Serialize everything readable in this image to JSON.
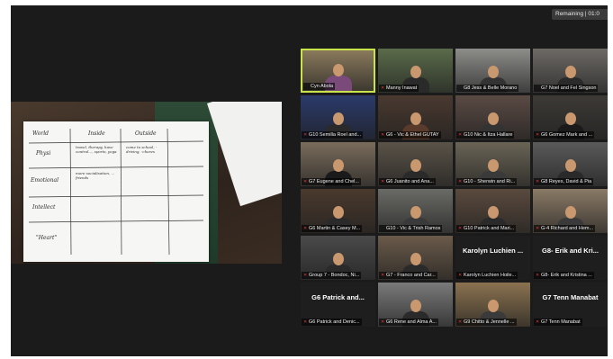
{
  "remaining": "Remaining | 01:0",
  "share": {
    "columns": [
      "World",
      "Inside",
      "Outside"
    ],
    "rows": [
      "Physi",
      "Emotional",
      "Intellect",
      "\"Heart\""
    ],
    "notes": [
      "travel, therapy, have control..., sports, yoga",
      "come to school, -driving, -chores",
      "more socialisation, ... friends"
    ]
  },
  "participants": [
    {
      "name": "Cyn Abola",
      "muted": false,
      "active": true,
      "text_only": false,
      "bg": "#8a7a5c",
      "shirt": "#7a4a7a"
    },
    {
      "name": "Manny Inawat",
      "muted": true,
      "active": false,
      "text_only": false,
      "bg": "#5a6b4a",
      "shirt": "#2a2a2a"
    },
    {
      "name": "G8 Jess & Belle Morano",
      "muted": false,
      "active": false,
      "text_only": false,
      "bg": "#8d8d8a",
      "shirt": "#333"
    },
    {
      "name": "G7 Noel and Fel Singson",
      "muted": false,
      "active": false,
      "text_only": false,
      "bg": "#6d6a66",
      "shirt": "#2a2a2a"
    },
    {
      "name": "G10 Semilla Roel and...",
      "muted": true,
      "active": false,
      "text_only": false,
      "bg": "#2b3a6a",
      "shirt": "#2a2a2a"
    },
    {
      "name": "G6 - Vic & Ethel GUTAY",
      "muted": true,
      "active": false,
      "text_only": false,
      "bg": "#4a3a30",
      "shirt": "#5a3a2a"
    },
    {
      "name": "G10 Nic & Itza Hallare",
      "muted": true,
      "active": false,
      "text_only": false,
      "bg": "#5a4a44",
      "shirt": "#333"
    },
    {
      "name": "G6 Gomez Mark and ...",
      "muted": true,
      "active": false,
      "text_only": false,
      "bg": "#3d3a36",
      "shirt": "#1a1a1a"
    },
    {
      "name": "G7 Eugene and Chel...",
      "muted": true,
      "active": false,
      "text_only": false,
      "bg": "#7a6c5c",
      "shirt": "#1a1a1a"
    },
    {
      "name": "G6 Juanito and Ana...",
      "muted": true,
      "active": false,
      "text_only": false,
      "bg": "#5a5348",
      "shirt": "#2a2a2a"
    },
    {
      "name": "G10 - Sherwin and Ri...",
      "muted": true,
      "active": false,
      "text_only": false,
      "bg": "#6a6456",
      "shirt": "#3a3a3a"
    },
    {
      "name": "G8 Reyes, David & Pia",
      "muted": true,
      "active": false,
      "text_only": false,
      "bg": "#5a5a5a",
      "shirt": "#2a2a2a"
    },
    {
      "name": "G6 Martin & Casey M...",
      "muted": true,
      "active": false,
      "text_only": false,
      "bg": "#4a3a2e",
      "shirt": "#2a2a2a"
    },
    {
      "name": "G10 - Vic & Trish Ramos",
      "muted": false,
      "active": false,
      "text_only": false,
      "bg": "#6a6a66",
      "shirt": "#3a3a3a"
    },
    {
      "name": "G10 Patrick and Mari...",
      "muted": true,
      "active": false,
      "text_only": false,
      "bg": "#5a4a3e",
      "shirt": "#2a2a2a"
    },
    {
      "name": "G-4 Richard and Hem...",
      "muted": true,
      "active": false,
      "text_only": false,
      "bg": "#8a7a66",
      "shirt": "#3a3a3a"
    },
    {
      "name": "Group 7 - Bondoc, Ni...",
      "muted": true,
      "active": false,
      "text_only": false,
      "bg": "#4a4a4a",
      "shirt": "#2a2a2a"
    },
    {
      "name": "G7 - Franco and Car...",
      "muted": true,
      "active": false,
      "text_only": false,
      "bg": "#6a5a4a",
      "shirt": "#2a2a2a"
    },
    {
      "name": "Karolyn Luchien Hoile...",
      "muted": true,
      "active": false,
      "text_only": true,
      "title": "Karolyn Luchien ..."
    },
    {
      "name": "G8- Erik and Kristina ...",
      "muted": true,
      "active": false,
      "text_only": true,
      "title": "G8- Erik and Kri..."
    },
    {
      "name": "G6 Patrick and Denic...",
      "muted": true,
      "active": false,
      "text_only": true,
      "title": "G6 Patrick and..."
    },
    {
      "name": "G6 Rene and Alma A...",
      "muted": true,
      "active": false,
      "text_only": false,
      "bg": "#7a7a7a",
      "shirt": "#2a2a2a"
    },
    {
      "name": "G9 Chitto & Jennelle ...",
      "muted": true,
      "active": false,
      "text_only": false,
      "bg": "#8a7250",
      "shirt": "#3a3a3a"
    },
    {
      "name": "G7 Tenn Manabat",
      "muted": true,
      "active": false,
      "text_only": true,
      "title": "G7 Tenn Manabat"
    }
  ]
}
